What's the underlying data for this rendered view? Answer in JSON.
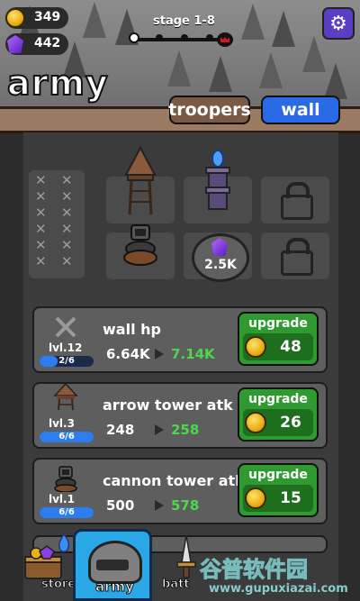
{
  "resources": {
    "coins": "349",
    "gems": "442"
  },
  "header": {
    "stage_label": "stage 1-8",
    "stage_progress_steps": 5,
    "stage_progress_current": 1,
    "settings_icon": "gear-icon",
    "title": "army"
  },
  "tabs": [
    {
      "label": "troopers",
      "active": false
    },
    {
      "label": "wall",
      "active": true
    }
  ],
  "grid": {
    "swords_count": 12,
    "unlock_cost": "2.5K",
    "locked_slots": 2
  },
  "upgrades": [
    {
      "name": "wall hp",
      "level": "lvl.12",
      "progress": "2/6",
      "progress_fraction": 0.33,
      "current": "6.64K",
      "next": "7.14K",
      "button_label": "upgrade",
      "cost": "48",
      "icon": "crossed-swords-icon"
    },
    {
      "name": "arrow tower atk",
      "level": "lvl.3",
      "progress": "6/6",
      "progress_fraction": 1.0,
      "current": "248",
      "next": "258",
      "button_label": "upgrade",
      "cost": "26",
      "icon": "arrow-tower-icon"
    },
    {
      "name": "cannon tower atk",
      "level": "lvl.1",
      "progress": "6/6",
      "progress_fraction": 1.0,
      "current": "500",
      "next": "578",
      "button_label": "upgrade",
      "cost": "15",
      "icon": "cannon-tower-icon"
    }
  ],
  "nav": {
    "store_label": "store",
    "army_label": "army",
    "battle_label": "batt"
  },
  "watermark": {
    "main": "谷普软件园",
    "sub": "www.gupuxiazai.com"
  },
  "colors": {
    "accent_blue": "#2a6ae6",
    "upgrade_green": "#2f9a2f",
    "next_value_green": "#4cd84c",
    "gem_purple": "#7b2fe0",
    "coin_gold": "#f0b41a"
  }
}
